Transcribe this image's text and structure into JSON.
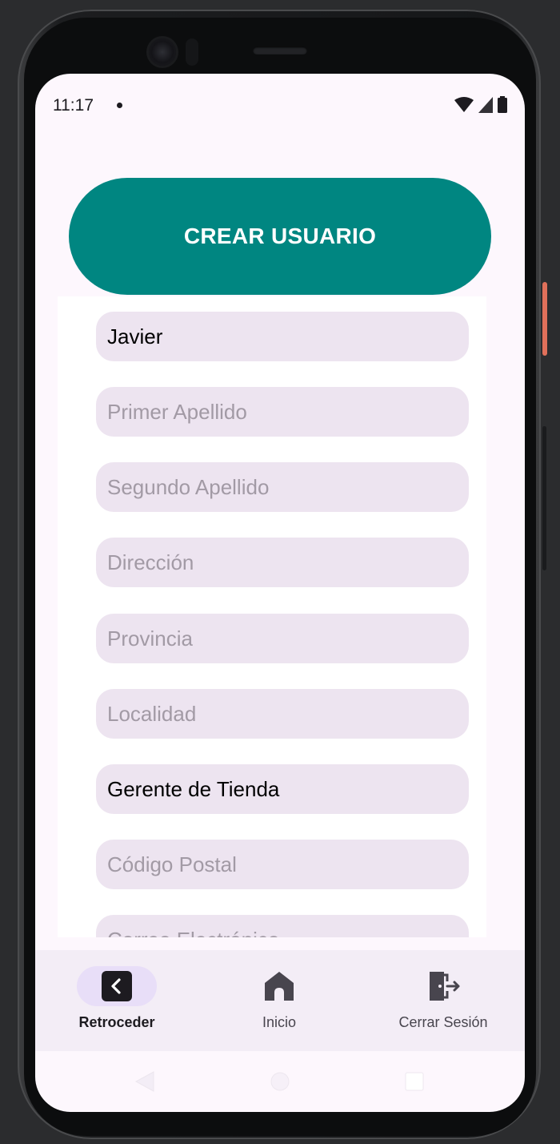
{
  "status_bar": {
    "time": "11:17"
  },
  "header": {
    "create_button_label": "CREAR USUARIO"
  },
  "form": {
    "fields": [
      {
        "value": "Javier",
        "placeholder": ""
      },
      {
        "value": "",
        "placeholder": "Primer Apellido"
      },
      {
        "value": "",
        "placeholder": "Segundo Apellido"
      },
      {
        "value": "",
        "placeholder": "Dirección"
      },
      {
        "value": "",
        "placeholder": "Provincia"
      },
      {
        "value": "",
        "placeholder": "Localidad"
      },
      {
        "value": "Gerente de Tienda",
        "placeholder": ""
      },
      {
        "value": "",
        "placeholder": "Código Postal"
      },
      {
        "value": "",
        "placeholder": "Correo Electrónico"
      }
    ]
  },
  "bottom_nav": {
    "items": [
      {
        "label": "Retroceder",
        "icon": "back-icon",
        "active": true
      },
      {
        "label": "Inicio",
        "icon": "home-icon",
        "active": false
      },
      {
        "label": "Cerrar Sesión",
        "icon": "logout-icon",
        "active": false
      }
    ]
  },
  "colors": {
    "primary": "#008681",
    "field_bg": "#ede4f0",
    "nav_bg": "#f3edf6",
    "nav_active": "#e8def8",
    "screen_bg": "#fdf7fd"
  }
}
